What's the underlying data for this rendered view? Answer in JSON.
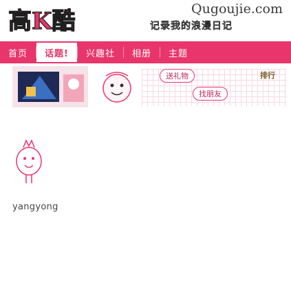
{
  "header": {
    "logo_text": "高K酷",
    "domain": "Qugoujie.com",
    "tagline": "记录我的浪漫日记"
  },
  "nav": {
    "items": [
      {
        "label": "首页",
        "active": false
      },
      {
        "label": "话题!",
        "active": true
      },
      {
        "label": "兴趣社",
        "active": false
      },
      {
        "label": "相册",
        "active": false
      },
      {
        "label": "主题",
        "active": false
      }
    ]
  },
  "profile": {
    "tags": {
      "gift": "送礼物",
      "meet": "找朋友",
      "list": "排行"
    }
  },
  "user": {
    "name": "yangyong"
  },
  "colors": {
    "accent": "#e8356b",
    "background": "#ffffff"
  }
}
